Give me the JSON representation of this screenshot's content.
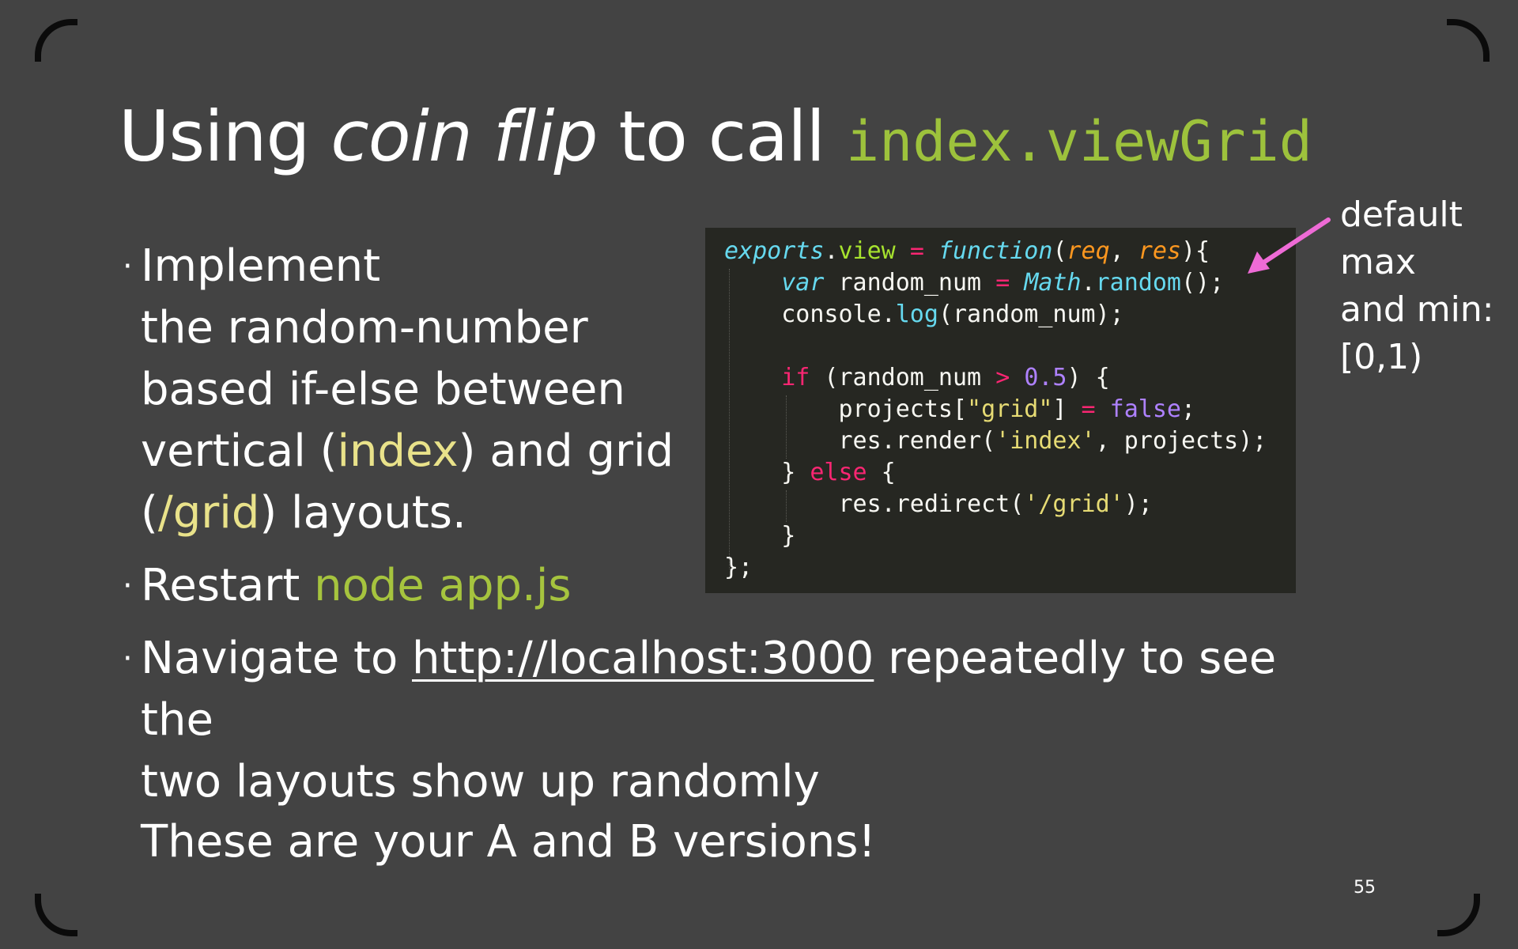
{
  "slide": {
    "title": {
      "part1": "Using ",
      "italic": "coin flip",
      "part2": " to call ",
      "code": "index.viewGrid"
    },
    "bullets": {
      "b1": {
        "line1": "Implement",
        "line2": "the random-number",
        "line3": "based if-else between",
        "line4_pre": "vertical (",
        "line4_hl": "index",
        "line4_post": ") and grid",
        "line5_pre": "(",
        "line5_hl": "/grid",
        "line5_post": ") layouts."
      },
      "b2": {
        "pre": "Restart ",
        "hl": "node app.js"
      },
      "b3": {
        "pre": "Navigate to ",
        "link": "http://localhost:3000",
        "post": " repeatedly to see the",
        "line2": "two layouts show up randomly"
      }
    },
    "closing": "These are your A and B versions!",
    "note": {
      "line1": "default",
      "line2": "max",
      "line3": "and min:",
      "line4": "[0,1)"
    },
    "page_number": "55",
    "colors": {
      "background": "#434343",
      "code_background": "#262722",
      "title_code": "#9dc23c",
      "highlight_yellow": "#e9e28a",
      "highlight_green": "#a6c43e",
      "arrow": "#ee6bd6"
    },
    "code": [
      [
        [
          "exports",
          "k-blue-i"
        ],
        [
          ".",
          ""
        ],
        [
          "view",
          "k-green"
        ],
        [
          " ",
          ""
        ],
        [
          "=",
          "k-pink"
        ],
        [
          " ",
          ""
        ],
        [
          "function",
          "k-blue-i"
        ],
        [
          "(",
          ""
        ],
        [
          "req",
          "k-orange-i"
        ],
        [
          ", ",
          ""
        ],
        [
          "res",
          "k-orange-i"
        ],
        [
          "){",
          ""
        ]
      ],
      [
        [
          "    ",
          ""
        ],
        [
          "var",
          "k-blue-i"
        ],
        [
          " random_num ",
          ""
        ],
        [
          "=",
          "k-pink"
        ],
        [
          " ",
          ""
        ],
        [
          "Math",
          "k-blue-i"
        ],
        [
          ".",
          ""
        ],
        [
          "random",
          "k-blue"
        ],
        [
          "();",
          ""
        ]
      ],
      [
        [
          "    console",
          ""
        ],
        [
          ".",
          ""
        ],
        [
          "log",
          "k-blue"
        ],
        [
          "(random_num);",
          ""
        ]
      ],
      [
        [
          "",
          ""
        ]
      ],
      [
        [
          "    ",
          ""
        ],
        [
          "if",
          "k-pink"
        ],
        [
          " (random_num ",
          ""
        ],
        [
          ">",
          "k-pink"
        ],
        [
          " ",
          ""
        ],
        [
          "0.5",
          "k-purple"
        ],
        [
          ") {",
          ""
        ]
      ],
      [
        [
          "        projects[",
          ""
        ],
        [
          "\"grid\"",
          "k-yellow"
        ],
        [
          "] ",
          ""
        ],
        [
          "=",
          "k-pink"
        ],
        [
          " ",
          ""
        ],
        [
          "false",
          "k-purple"
        ],
        [
          ";",
          ""
        ]
      ],
      [
        [
          "        res.render(",
          ""
        ],
        [
          "'index'",
          "k-yellow"
        ],
        [
          ", projects);",
          ""
        ]
      ],
      [
        [
          "    } ",
          ""
        ],
        [
          "else",
          "k-pink"
        ],
        [
          " {",
          ""
        ]
      ],
      [
        [
          "        res.redirect(",
          ""
        ],
        [
          "'/grid'",
          "k-yellow"
        ],
        [
          ");",
          ""
        ]
      ],
      [
        [
          "    }",
          ""
        ]
      ],
      [
        [
          "};",
          ""
        ]
      ]
    ]
  }
}
